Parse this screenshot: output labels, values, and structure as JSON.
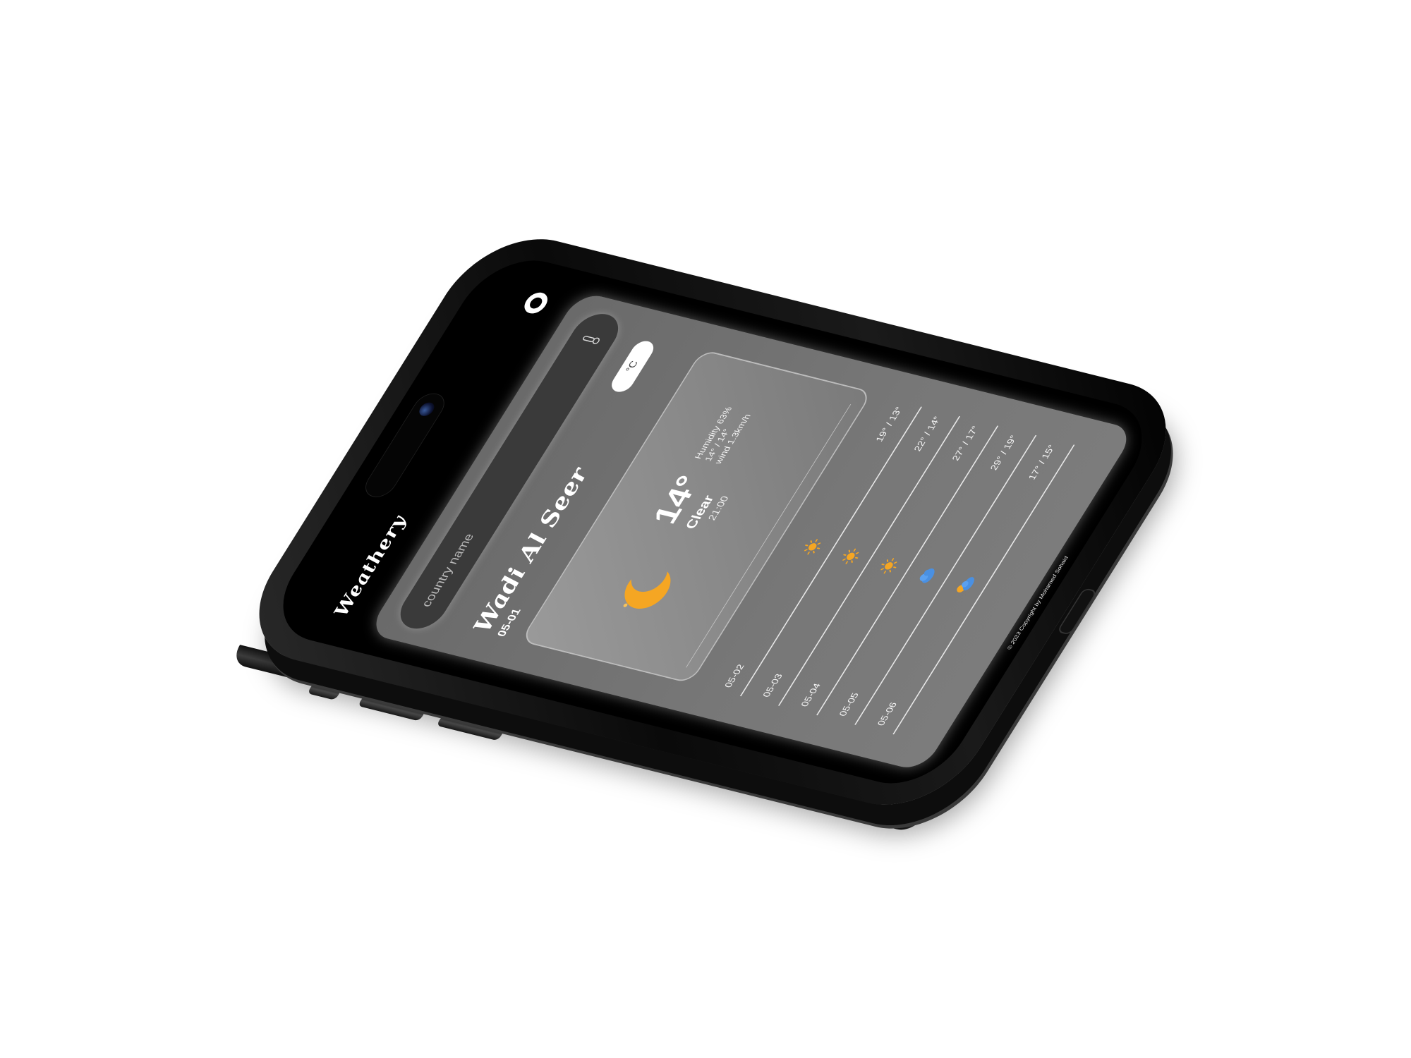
{
  "app": {
    "title": "Weathery"
  },
  "search": {
    "placeholder": "country name"
  },
  "unit_toggle": {
    "label": "°C"
  },
  "location": {
    "city": "Wadi Al Seer",
    "date": "05-01"
  },
  "current": {
    "temperature": "14°",
    "condition": "Clear",
    "time": "21:00",
    "humidity": "Humidity 63%",
    "range": "14° / 14°",
    "wind": "wind 1.3km/h",
    "icon": "moon-cloud-icon"
  },
  "forecast": [
    {
      "date": "05-02",
      "icon": "sun-icon",
      "range": "19° / 13°"
    },
    {
      "date": "05-03",
      "icon": "sun-icon",
      "range": "22° / 14°"
    },
    {
      "date": "05-04",
      "icon": "sun-icon",
      "range": "27° / 17°"
    },
    {
      "date": "05-05",
      "icon": "cloud-rain-icon",
      "range": "29° / 19°"
    },
    {
      "date": "05-06",
      "icon": "sun-cloud-icon",
      "range": "17° / 15°"
    }
  ],
  "footer": {
    "text": "© 2023 Copyright by Mohamed Sohaid"
  },
  "colors": {
    "accent": "#f5a623",
    "cloud": "#4a90e2",
    "card": "#777777"
  }
}
